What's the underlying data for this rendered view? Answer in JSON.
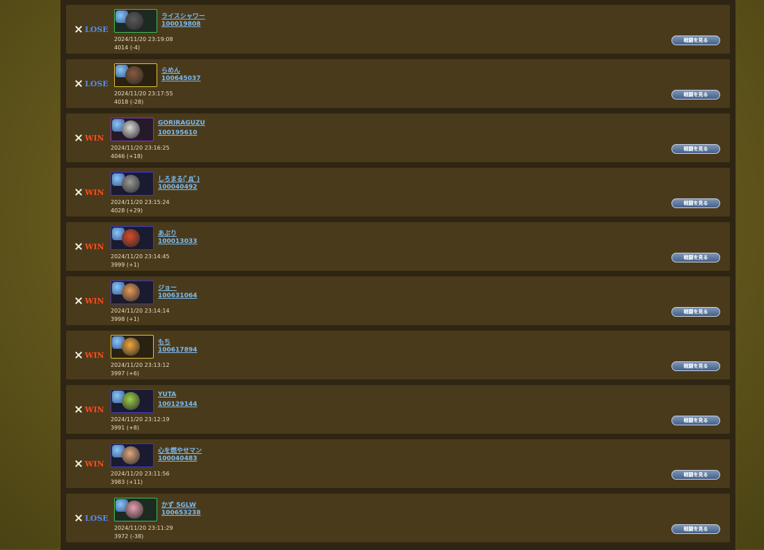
{
  "colors": {
    "lose": "#4f8ff0",
    "win": "#ff4a1a",
    "link": "#7bbcf0",
    "row_bg": "#4a3a1c"
  },
  "battles": [
    {
      "result": "LOSE",
      "name": "ライスシャワー",
      "uid": "100019808",
      "time": "2024/11/20 23:19:08",
      "rate": "4014 (-4)",
      "button": "戦闘を見る",
      "frame": "green",
      "face": "#5a5a5a"
    },
    {
      "result": "LOSE",
      "name": "らめん",
      "uid": "100645037",
      "time": "2024/11/20 23:17:55",
      "rate": "4018 (-28)",
      "button": "戦闘を見る",
      "frame": "yellow",
      "face": "#8a5a3a"
    },
    {
      "result": "WIN",
      "name": "GORIRAGUZU",
      "uid": "100195610",
      "time": "2024/11/20 23:16:25",
      "rate": "4046 (+18)",
      "button": "戦闘を見る",
      "frame": "purple",
      "face": "#d8d8d8"
    },
    {
      "result": "WIN",
      "name": "しろまる(ﾟДﾟ)",
      "uid": "100040492",
      "time": "2024/11/20 23:15:24",
      "rate": "4028 (+29)",
      "button": "戦闘を見る",
      "frame": "blue",
      "face": "#9a9a9a"
    },
    {
      "result": "WIN",
      "name": "あぶり",
      "uid": "100013033",
      "time": "2024/11/20 23:14:45",
      "rate": "3999 (+1)",
      "button": "戦闘を見る",
      "frame": "blue",
      "face": "#d84a2a"
    },
    {
      "result": "WIN",
      "name": "ジョー",
      "uid": "100631064",
      "time": "2024/11/20 23:14:14",
      "rate": "3998 (+1)",
      "button": "戦闘を見る",
      "frame": "blue",
      "face": "#e89a5a"
    },
    {
      "result": "WIN",
      "name": "もち",
      "uid": "100617894",
      "time": "2024/11/20 23:13:12",
      "rate": "3997 (+6)",
      "button": "戦闘を見る",
      "frame": "yellow",
      "face": "#f0a83a"
    },
    {
      "result": "WIN",
      "name": "YUTA",
      "uid": "100129144",
      "time": "2024/11/20 23:12:19",
      "rate": "3991 (+8)",
      "button": "戦闘を見る",
      "frame": "blue",
      "face": "#9ad04a"
    },
    {
      "result": "WIN",
      "name": "心を燃やせマン",
      "uid": "100040483",
      "time": "2024/11/20 23:11:56",
      "rate": "3983 (+11)",
      "button": "戦闘を見る",
      "frame": "blue",
      "face": "#e0a880"
    },
    {
      "result": "LOSE",
      "name": "かず 5GLW",
      "uid": "100653238",
      "time": "2024/11/20 23:11:29",
      "rate": "3972 (-38)",
      "button": "戦闘を見る",
      "frame": "green",
      "face": "#e8a0b0"
    }
  ]
}
